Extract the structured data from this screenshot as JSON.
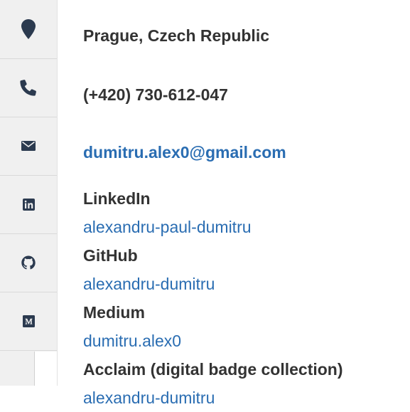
{
  "contact": {
    "location": "Prague, Czech Republic",
    "phone": "(+420) 730-612-047",
    "email": "dumitru.alex0@gmail.com"
  },
  "profiles": [
    {
      "label": "LinkedIn",
      "value": "alexandru-paul-dumitru"
    },
    {
      "label": "GitHub",
      "value": "alexandru-dumitru"
    },
    {
      "label": "Medium",
      "value": "dumitru.alex0"
    },
    {
      "label": "Acclaim (digital badge collection)",
      "value": "alexandru-dumitru"
    }
  ],
  "icons": [
    "map-marker-icon",
    "phone-icon",
    "envelope-icon",
    "linkedin-icon",
    "github-icon",
    "medium-icon"
  ],
  "colors": {
    "text": "#333333",
    "link": "#2a6db2",
    "icon": "#2b3a4f",
    "icon_column_bg": "#f0f0f0"
  }
}
